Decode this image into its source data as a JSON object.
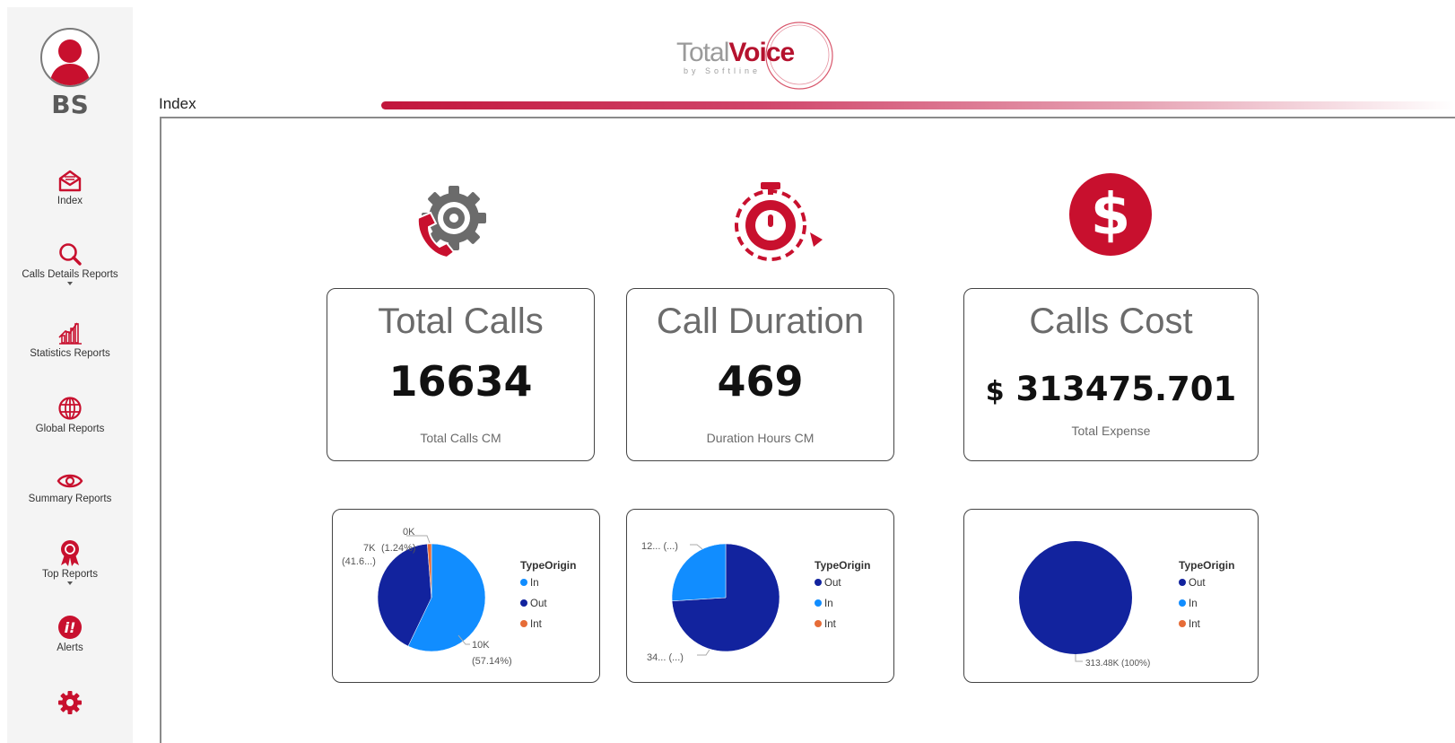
{
  "user": {
    "initials": "BS"
  },
  "sidebar": {
    "items": [
      {
        "label": "Index",
        "icon": "envelope-open-icon"
      },
      {
        "label": "Calls Details Reports",
        "icon": "magnifier-icon"
      },
      {
        "label": "Statistics Reports",
        "icon": "bar-chart-icon"
      },
      {
        "label": "Global Reports",
        "icon": "globe-icon"
      },
      {
        "label": "Summary Reports",
        "icon": "eye-icon"
      },
      {
        "label": "Top Reports",
        "icon": "award-ribbon-icon"
      },
      {
        "label": "Alerts",
        "icon": "alert-info-icon"
      },
      {
        "label": "",
        "icon": "gear-icon"
      }
    ]
  },
  "brand": {
    "name_light": "Total",
    "name_bold": "Voice",
    "tagline": "by Softline",
    "accent": "#c2163c"
  },
  "page": {
    "title": "Index"
  },
  "kpis": [
    {
      "title": "Total Calls",
      "value": "16634",
      "subtitle": "Total Calls CM",
      "icon": "phone-gear-icon"
    },
    {
      "title": "Call Duration",
      "value": "469",
      "subtitle": "Duration Hours CM",
      "icon": "stopwatch-icon"
    },
    {
      "title": "Calls Cost",
      "currency": "$",
      "value": "313475.701",
      "subtitle": "Total Expense",
      "icon": "dollar-coin-icon"
    }
  ],
  "colors": {
    "In": "#118dff",
    "Out": "#12239e",
    "Int": "#e66c37"
  },
  "chart_data": [
    {
      "type": "pie",
      "legend_title": "TypeOrigin",
      "legend": [
        "In",
        "Out",
        "Int"
      ],
      "slices": [
        {
          "name": "In",
          "value": 57.14,
          "label": "10K (57.14%)"
        },
        {
          "name": "Out",
          "value": 41.62,
          "label": "7K (41.6...)"
        },
        {
          "name": "Int",
          "value": 1.24,
          "label": "0K (1.24%)"
        }
      ],
      "labels": {
        "in_a": "10K",
        "in_b": "(57.14%)",
        "out_a": "7K",
        "out_b": "(41.6...)",
        "int_a": "0K",
        "int_b": "(1.24%)"
      },
      "legend_position": "right"
    },
    {
      "type": "pie",
      "legend_title": "TypeOrigin",
      "legend": [
        "Out",
        "In",
        "Int"
      ],
      "slices": [
        {
          "name": "Out",
          "value": 74,
          "label": "34... (...)"
        },
        {
          "name": "In",
          "value": 26,
          "label": "12... (...)"
        }
      ],
      "labels": {
        "out": "34... (...)",
        "in": "12... (...)"
      },
      "legend_position": "right"
    },
    {
      "type": "pie",
      "legend_title": "TypeOrigin",
      "legend": [
        "Out",
        "In",
        "Int"
      ],
      "slices": [
        {
          "name": "Out",
          "value": 100,
          "label": "313.48K (100%)"
        }
      ],
      "labels": {
        "out": "313.48K (100%)"
      },
      "legend_position": "right"
    }
  ]
}
